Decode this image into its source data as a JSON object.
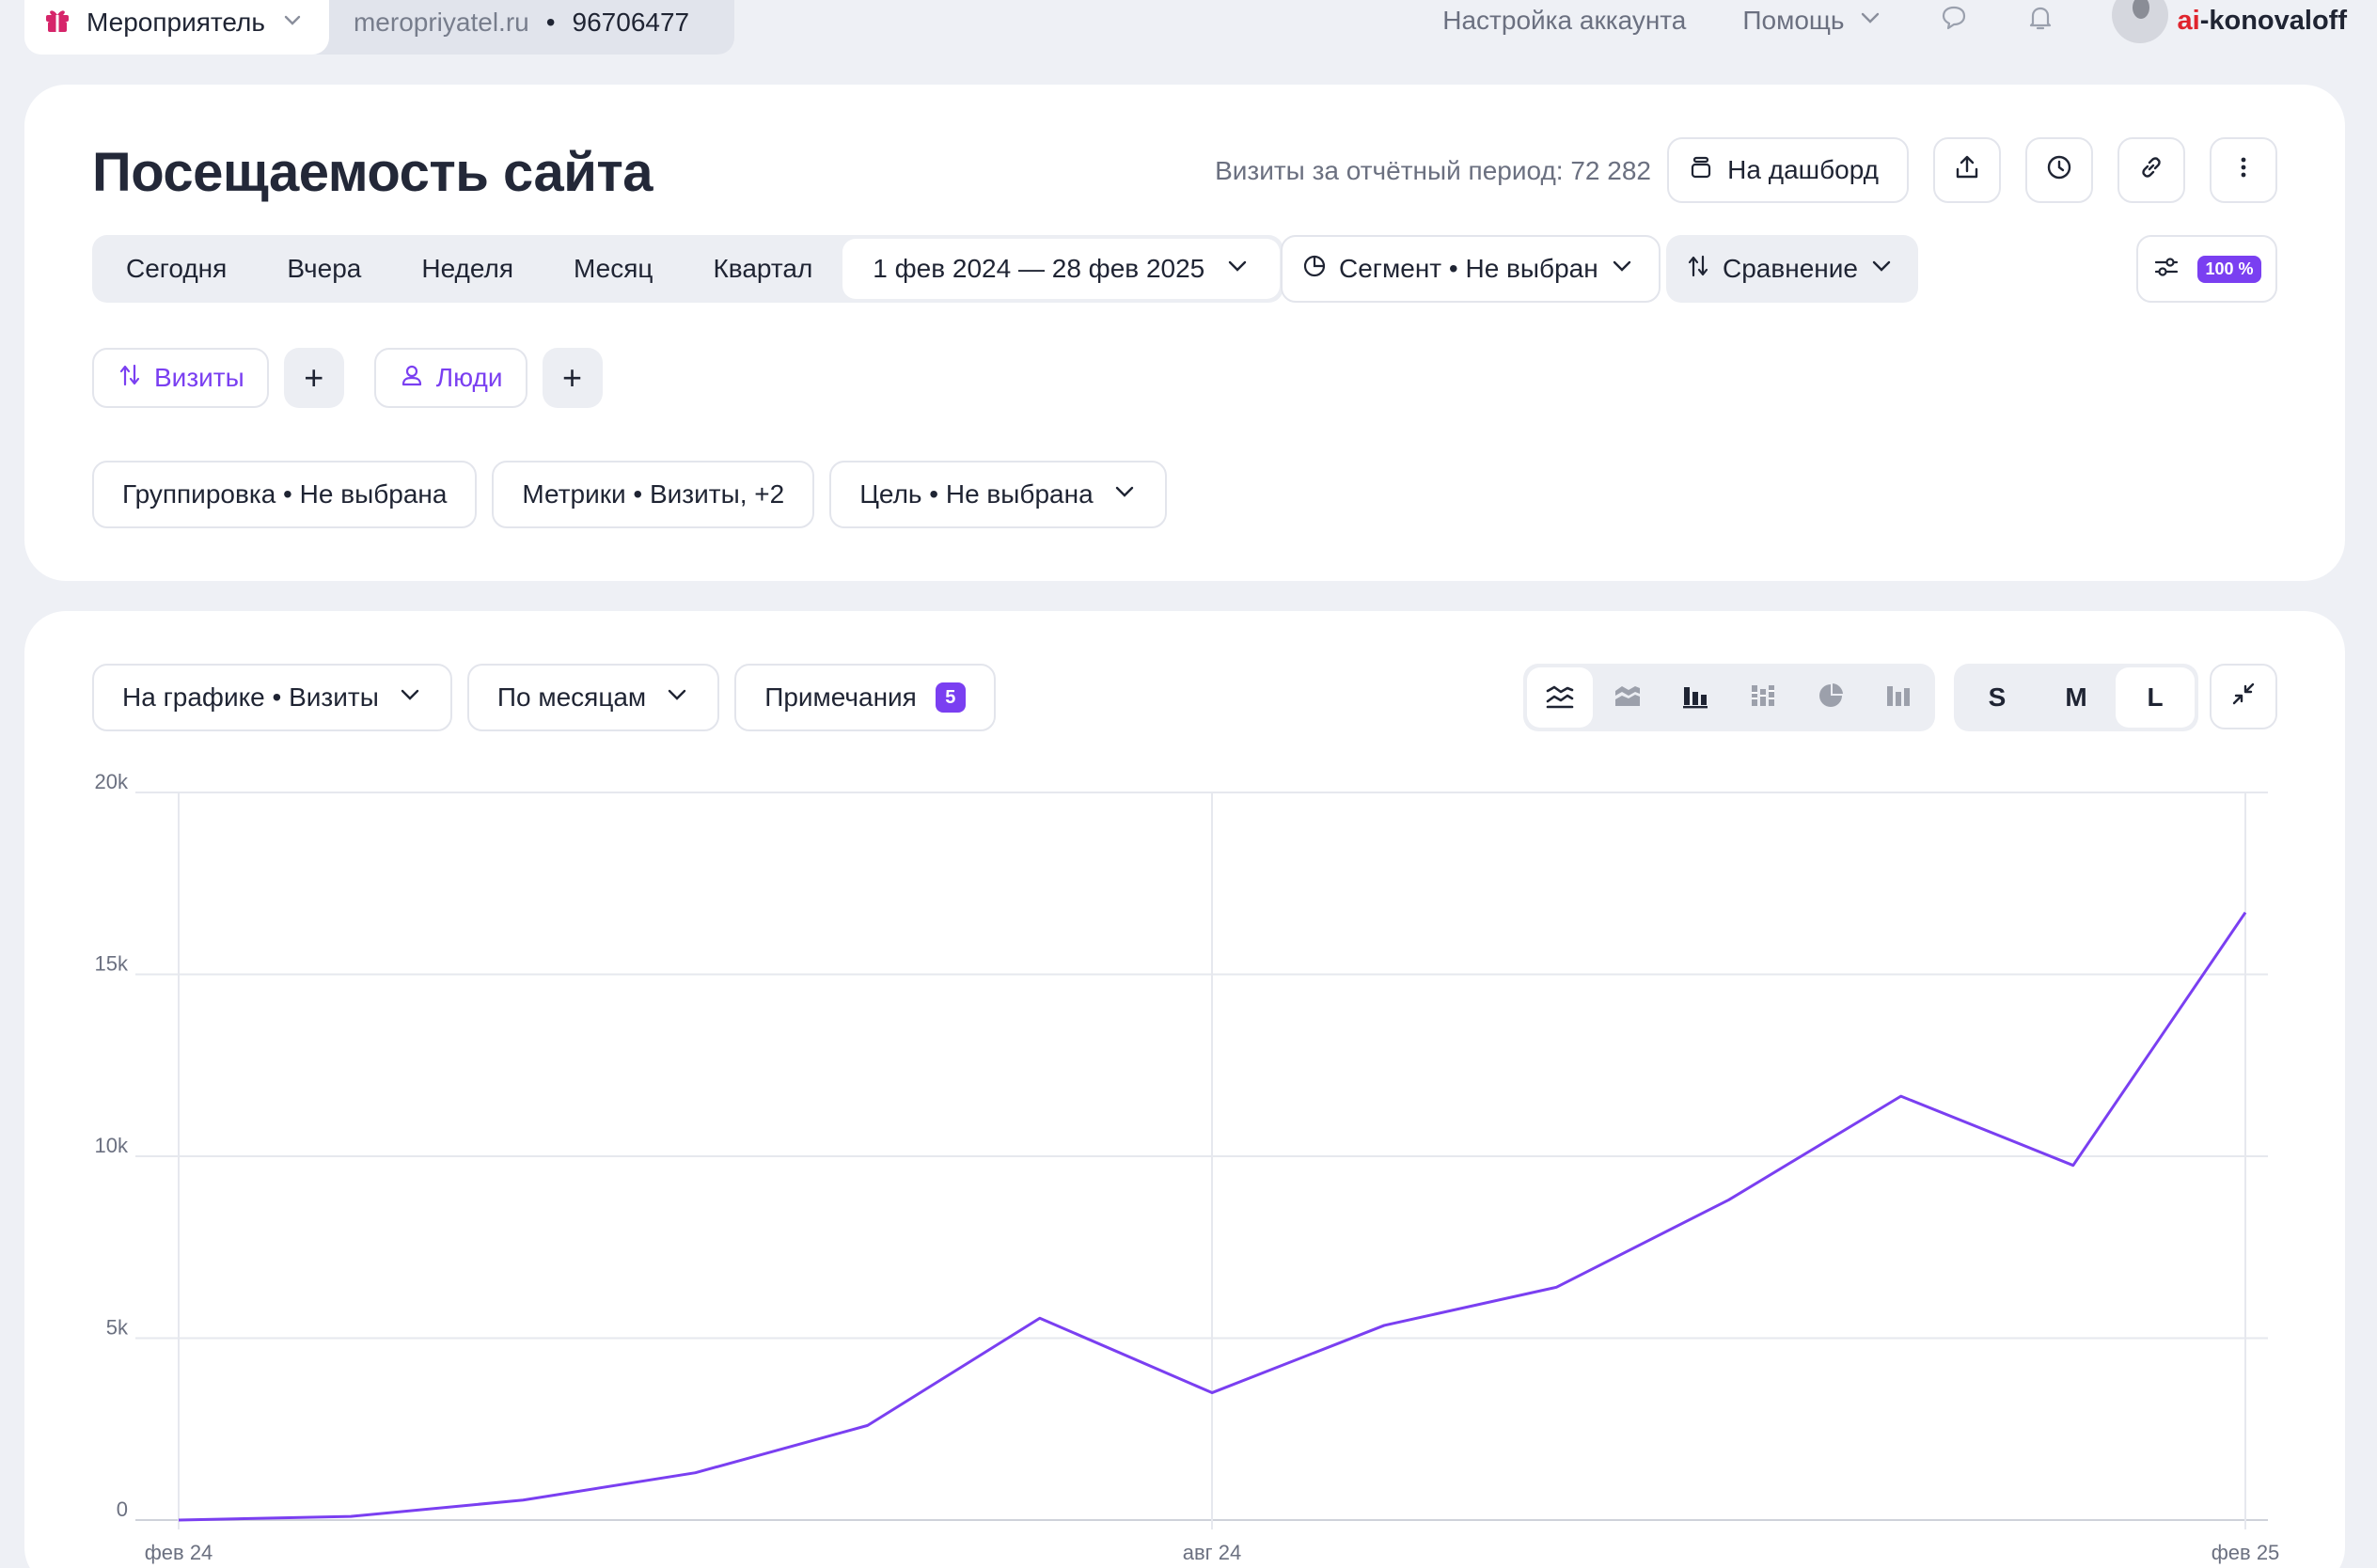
{
  "topbar": {
    "site_name": "Мероприятель",
    "site_domain": "meropriyatel.ru",
    "separator": "•",
    "counter_id": "96706477",
    "account_settings": "Настройка аккаунта",
    "help": "Помощь",
    "user_prefix": "ai",
    "user_rest": "-konovaloff"
  },
  "header": {
    "title": "Посещаемость сайта",
    "visits_total": "Визиты за отчётный период: 72 282",
    "dashboard_label": "На дашборд"
  },
  "periods": {
    "items": [
      "Сегодня",
      "Вчера",
      "Неделя",
      "Месяц",
      "Квартал"
    ],
    "range_label": "1 фев 2024 — 28 фев 2025"
  },
  "segment_label": "Сегмент • Не выбран",
  "compare_label": "Сравнение",
  "sampling_pct": "100 %",
  "chips": {
    "visits": "Визиты",
    "people": "Люди",
    "plus": "+"
  },
  "filters": {
    "grouping": "Группировка • Не выбрана",
    "metrics": "Метрики • Визиты, +2",
    "goal": "Цель • Не выбрана"
  },
  "chart_controls": {
    "on_chart": "На графике • Визиты",
    "granularity": "По месяцам",
    "notes": "Примечания",
    "notes_count": "5",
    "sizes": [
      "S",
      "M",
      "L"
    ],
    "active_size": "L",
    "active_type": "line"
  },
  "colors": {
    "accent": "#7a3ff1",
    "brand_red": "#e0242d",
    "gift": "#d6256a"
  },
  "chart_data": {
    "type": "line",
    "x": [
      "2024-02",
      "2024-03",
      "2024-04",
      "2024-05",
      "2024-06",
      "2024-07",
      "2024-08",
      "2024-09",
      "2024-10",
      "2024-11",
      "2024-12",
      "2025-01",
      "2025-02"
    ],
    "series": [
      {
        "values": [
          0,
          100,
          550,
          1300,
          2600,
          5550,
          3500,
          5350,
          6400,
          8800,
          11650,
          9750,
          16700
        ]
      }
    ],
    "x_tick_labels": [
      {
        "index": 0,
        "label": "фев 24"
      },
      {
        "index": 6,
        "label": "авг 24"
      },
      {
        "index": 12,
        "label": "фев 25"
      }
    ],
    "y_ticks": [
      0,
      5000,
      10000,
      15000,
      20000
    ],
    "y_tick_labels": [
      "0",
      "5k",
      "10k",
      "15k",
      "20k"
    ],
    "ylim": [
      0,
      20000
    ],
    "grid": true,
    "legend": "none"
  }
}
